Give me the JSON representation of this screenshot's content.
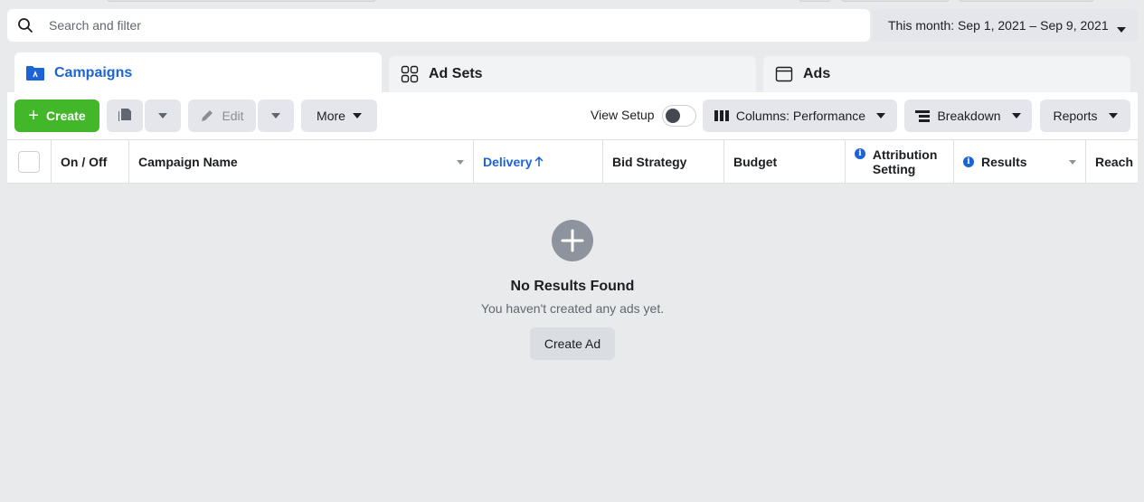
{
  "search": {
    "placeholder": "Search and filter"
  },
  "date_range": {
    "label": "This month: Sep 1, 2021 – Sep 9, 2021"
  },
  "tabs": [
    {
      "label": "Campaigns",
      "icon": "folder-icon",
      "active": true
    },
    {
      "label": "Ad Sets",
      "icon": "grid-icon",
      "active": false
    },
    {
      "label": "Ads",
      "icon": "ad-window-icon",
      "active": false
    }
  ],
  "toolbar": {
    "create_label": "Create",
    "edit_label": "Edit",
    "more_label": "More",
    "view_setup_label": "View Setup",
    "view_setup_on": false,
    "columns_label": "Columns: Performance",
    "breakdown_label": "Breakdown",
    "reports_label": "Reports"
  },
  "table": {
    "columns": [
      "On / Off",
      "Campaign Name",
      "Delivery",
      "Bid Strategy",
      "Budget",
      "Attribution Setting",
      "Results",
      "Reach"
    ],
    "sorted_column": "Delivery",
    "sort_direction": "ascending"
  },
  "empty_state": {
    "title": "No Results Found",
    "subtitle": "You haven't created any ads yet.",
    "button_label": "Create Ad"
  },
  "colors": {
    "accent_blue": "#1b64d8",
    "create_green": "#42b72a"
  }
}
